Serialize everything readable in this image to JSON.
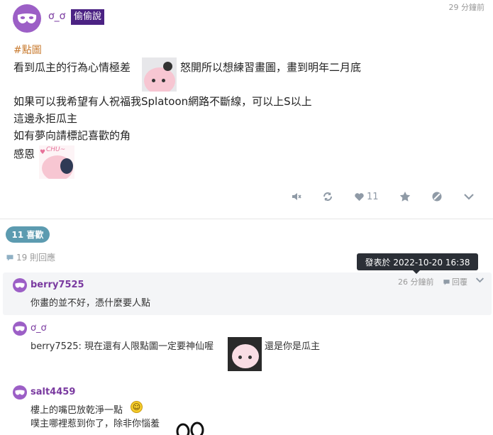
{
  "post": {
    "author": "ơ_ơ",
    "badge": "偷偷說",
    "time": "29 分鐘前",
    "tag": "#點圖",
    "line1_before": "看到瓜主的行為心情極差",
    "line1_after": "怒開所以想練習畫圖，畫到明年二月底",
    "line2": "如果可以我希望有人祝福我Splatoon網路不斷線，可以上S以上",
    "line3": "這邊永拒瓜主",
    "line4": "如有夢向請標記喜歡的角",
    "line5": "感恩",
    "sticker2_text": "CHU~",
    "like_count": "11"
  },
  "likes": {
    "label": "11 喜歡"
  },
  "replies": {
    "label": "19 則回應"
  },
  "tooltip": {
    "text": "發表於 2022-10-20 16:38"
  },
  "comments": [
    {
      "author": "berry7525",
      "text": "你畫的並不好，憑什麼要人點",
      "time": "26 分鐘前",
      "reply_label": "回覆"
    },
    {
      "author": "ơ_ơ",
      "text_before": "berry7525: 現在還有人限點圖一定要神仙喔",
      "text_after": "還是你是瓜主"
    },
    {
      "author": "salt4459",
      "line1": "樓上的嘴巴放乾淨一點",
      "line2": "噗主哪裡惹到你了，除非你惱羞"
    }
  ],
  "colors": {
    "accent": "#7a3aa0",
    "badge_bg": "#4b2283",
    "likes_bg": "#5c9bb0",
    "tag": "#c87a2e"
  },
  "icons": [
    "mask-icon",
    "mute-icon",
    "replurk-icon",
    "heart-icon",
    "star-icon",
    "block-icon",
    "chevron-down-icon",
    "comment-bubble-icon",
    "emoji-smile-icon"
  ]
}
